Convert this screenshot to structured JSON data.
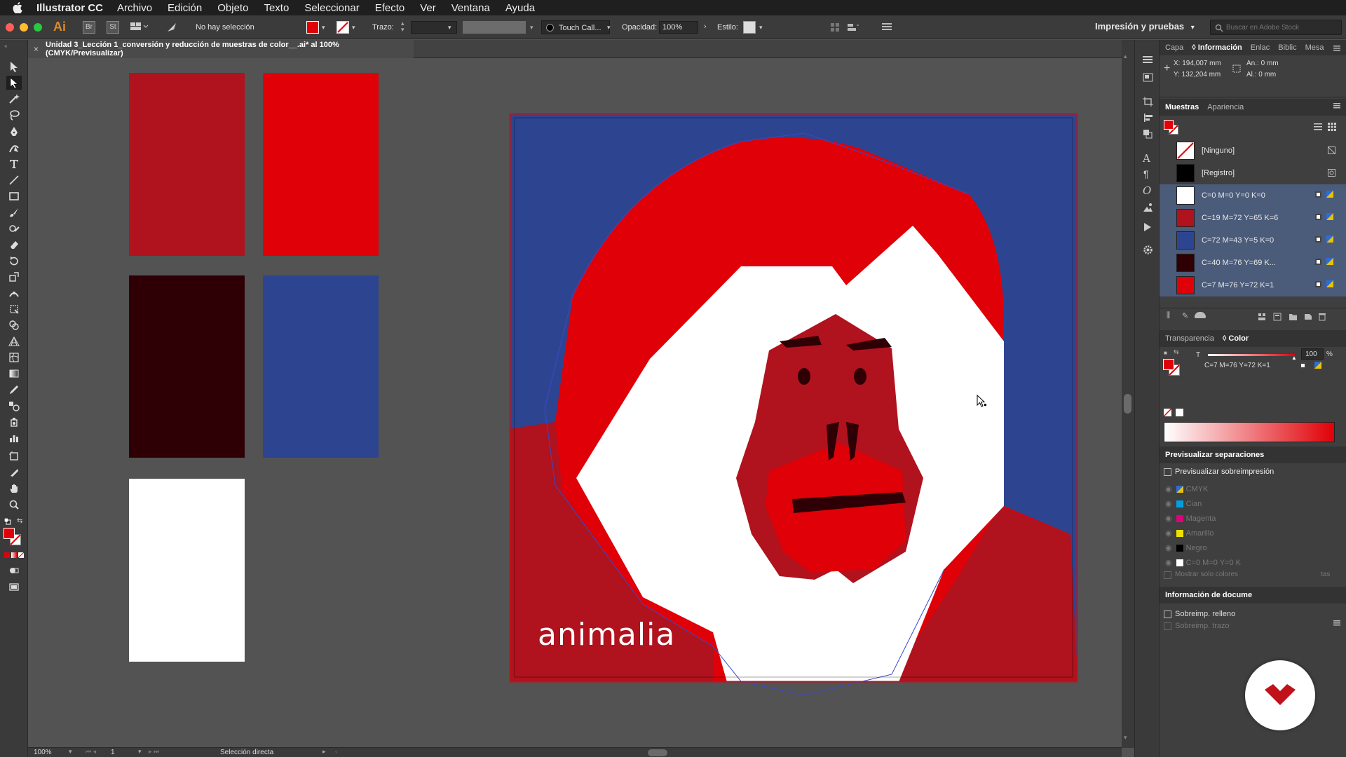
{
  "menubar": {
    "app_name": "Illustrator CC",
    "items": [
      "Archivo",
      "Edición",
      "Objeto",
      "Texto",
      "Seleccionar",
      "Efecto",
      "Ver",
      "Ventana",
      "Ayuda"
    ]
  },
  "controlbar": {
    "app_logo": "Ai",
    "br": "Br",
    "st": "St",
    "selection": "No hay selección",
    "trazo_label": "Trazo:",
    "brush_name": "Touch Call...",
    "opacity_label": "Opacidad:",
    "opacity_value": "100%",
    "style_label": "Estilo:",
    "workspace": "Impresión y pruebas",
    "search_placeholder": "Buscar en Adobe Stock"
  },
  "document": {
    "tab_title": "Unidad 3_Lección 1_conversión y reducción de muestras de color__.ai* al 100% (CMYK/Previsualizar)",
    "logo_text": "animalia"
  },
  "info_panel": {
    "tabs": [
      "Capa",
      "Información",
      "Enlac",
      "Biblic",
      "Mesa"
    ],
    "x": "X: 194,007 mm",
    "y": "Y: 132,204 mm",
    "w": "An.: 0 mm",
    "h": "Al.: 0 mm"
  },
  "swatches_panel": {
    "tabs": [
      "Muestras",
      "Apariencia"
    ],
    "items": [
      {
        "name": "[Ninguno]",
        "color": "none"
      },
      {
        "name": "[Registro]",
        "color": "#000000"
      },
      {
        "name": "C=0 M=0 Y=0 K=0",
        "color": "#ffffff"
      },
      {
        "name": "C=19 M=72 Y=65 K=6",
        "color": "#b0121e"
      },
      {
        "name": "C=72 M=43 Y=5 K=0",
        "color": "#2d4591"
      },
      {
        "name": "C=40 M=76 Y=69 K...",
        "color": "#2e0005"
      },
      {
        "name": "C=7 M=76 Y=72 K=1",
        "color": "#e00007"
      }
    ]
  },
  "color_panel": {
    "tabs": [
      "Transparencia",
      "Color"
    ],
    "t_label": "T",
    "value": "100",
    "percent": "%",
    "name": "C=7 M=76 Y=72 K=1"
  },
  "separations_panel": {
    "title": "Previsualizar separaciones",
    "overprint": "Previsualizar sobreimpresión",
    "plates": [
      "CMYK",
      "Cian",
      "Magenta",
      "Amarillo",
      "Negro",
      "C=0 M=0 Y=0 K"
    ],
    "only_colors": "Mostrar solo colores",
    "only_colors_end": "tas"
  },
  "docinfo_panel": {
    "title": "Información de docume",
    "items": [
      "Sobreimp. relleno",
      "Sobreimp. trazo"
    ]
  },
  "statusbar": {
    "zoom": "100%",
    "artboard": "1",
    "tool": "Selección directa"
  },
  "colors": {
    "red": "#e00007",
    "dark_red": "#b0121e",
    "maroon": "#2e0005",
    "blue": "#2d4591",
    "white": "#ffffff"
  }
}
